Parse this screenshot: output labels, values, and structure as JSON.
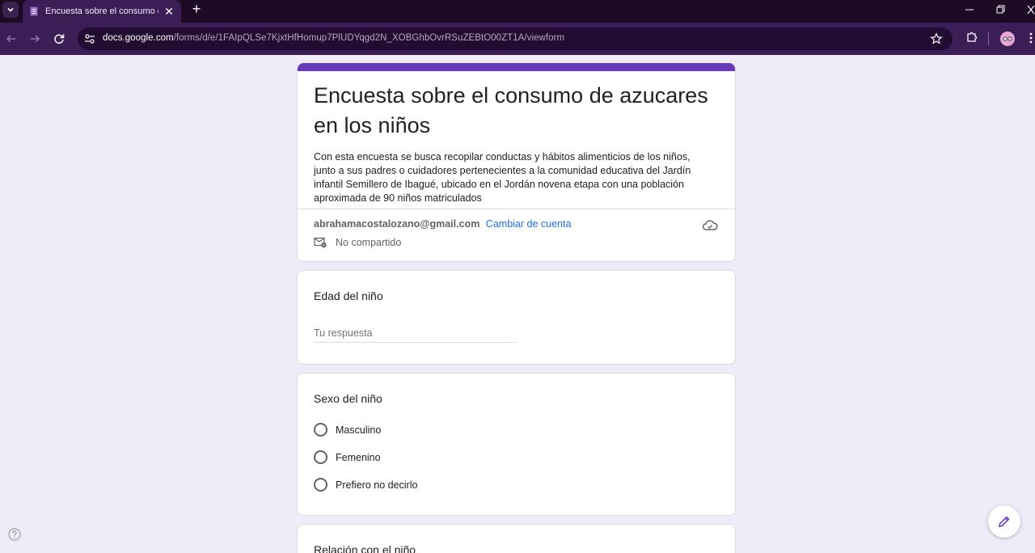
{
  "browser": {
    "tab_title": "Encuesta sobre el consumo de azucares en los niños",
    "url_host": "docs.google.com",
    "url_path": "/forms/d/e/1FAIpQLSe7KjxtHfHomup7PlUDYqgd2N_XOBGhbOvrRSuZEBtO00ZT1A/viewform"
  },
  "form": {
    "title": "Encuesta sobre el consumo de azucares en los niños",
    "description": "Con esta encuesta se busca recopilar conductas y hábitos alimenticios de los niños, junto a sus padres o cuidadores pertenecientes a la comunidad educativa del Jardín infantil Semillero de Ibagué, ubicado en el Jordán novena etapa con una población aproximada de 90 niños matriculados",
    "account_email": "abrahamacostalozano@gmail.com",
    "switch_account": "Cambiar de cuenta",
    "shared_status": "No compartido"
  },
  "questions": [
    {
      "title": "Edad del niño",
      "placeholder": "Tu respuesta"
    },
    {
      "title": "Sexo del niño",
      "options": [
        "Masculino",
        "Femenino",
        "Prefiero no decirlo"
      ]
    },
    {
      "title": "Relación con el niño"
    }
  ],
  "colors": {
    "accent": "#673ab7",
    "background": "#f0ebf8",
    "link": "#1a73e8",
    "chrome": "#3b1e55"
  },
  "icons": {
    "help": "help-circle-icon",
    "edit": "pencil-icon",
    "cloud": "cloud-check-icon",
    "shared": "mail-shared-icon"
  }
}
